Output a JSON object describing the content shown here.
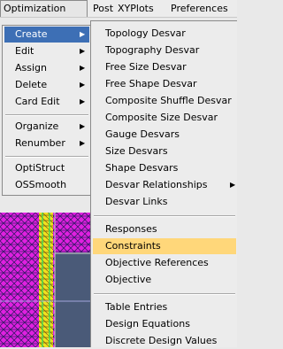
{
  "menubar": {
    "items": [
      "Optimization",
      "Post",
      "XYPlots",
      "Preferences"
    ]
  },
  "left_menu": {
    "items": [
      {
        "label": "Create"
      },
      {
        "label": "Edit"
      },
      {
        "label": "Assign"
      },
      {
        "label": "Delete"
      },
      {
        "label": "Card Edit"
      },
      {
        "label": "Organize"
      },
      {
        "label": "Renumber"
      },
      {
        "label": "OptiStruct"
      },
      {
        "label": "OSSmooth"
      }
    ]
  },
  "submenu": {
    "items": [
      {
        "label": "Topology Desvar"
      },
      {
        "label": "Topography Desvar"
      },
      {
        "label": "Free Size Desvar"
      },
      {
        "label": "Free Shape Desvar"
      },
      {
        "label": "Composite Shuffle Desvar"
      },
      {
        "label": "Composite Size Desvar"
      },
      {
        "label": "Gauge Desvars"
      },
      {
        "label": "Size Desvars"
      },
      {
        "label": "Shape Desvars"
      },
      {
        "label": "Desvar Relationships"
      },
      {
        "label": "Desvar Links"
      },
      {
        "label": "Responses"
      },
      {
        "label": "Constraints"
      },
      {
        "label": "Objective References"
      },
      {
        "label": "Objective"
      },
      {
        "label": "Table Entries"
      },
      {
        "label": "Design Equations"
      },
      {
        "label": "Discrete Design Values"
      }
    ]
  },
  "colors": {
    "selection": "#3d6fb5",
    "hover_highlight": "#ffd77a",
    "viewport_background": "#4a5a78",
    "mesh_magenta": "#e020e0",
    "mesh_yellow": "#f0e020"
  },
  "icons": [
    "submenu-arrow-icon"
  ]
}
